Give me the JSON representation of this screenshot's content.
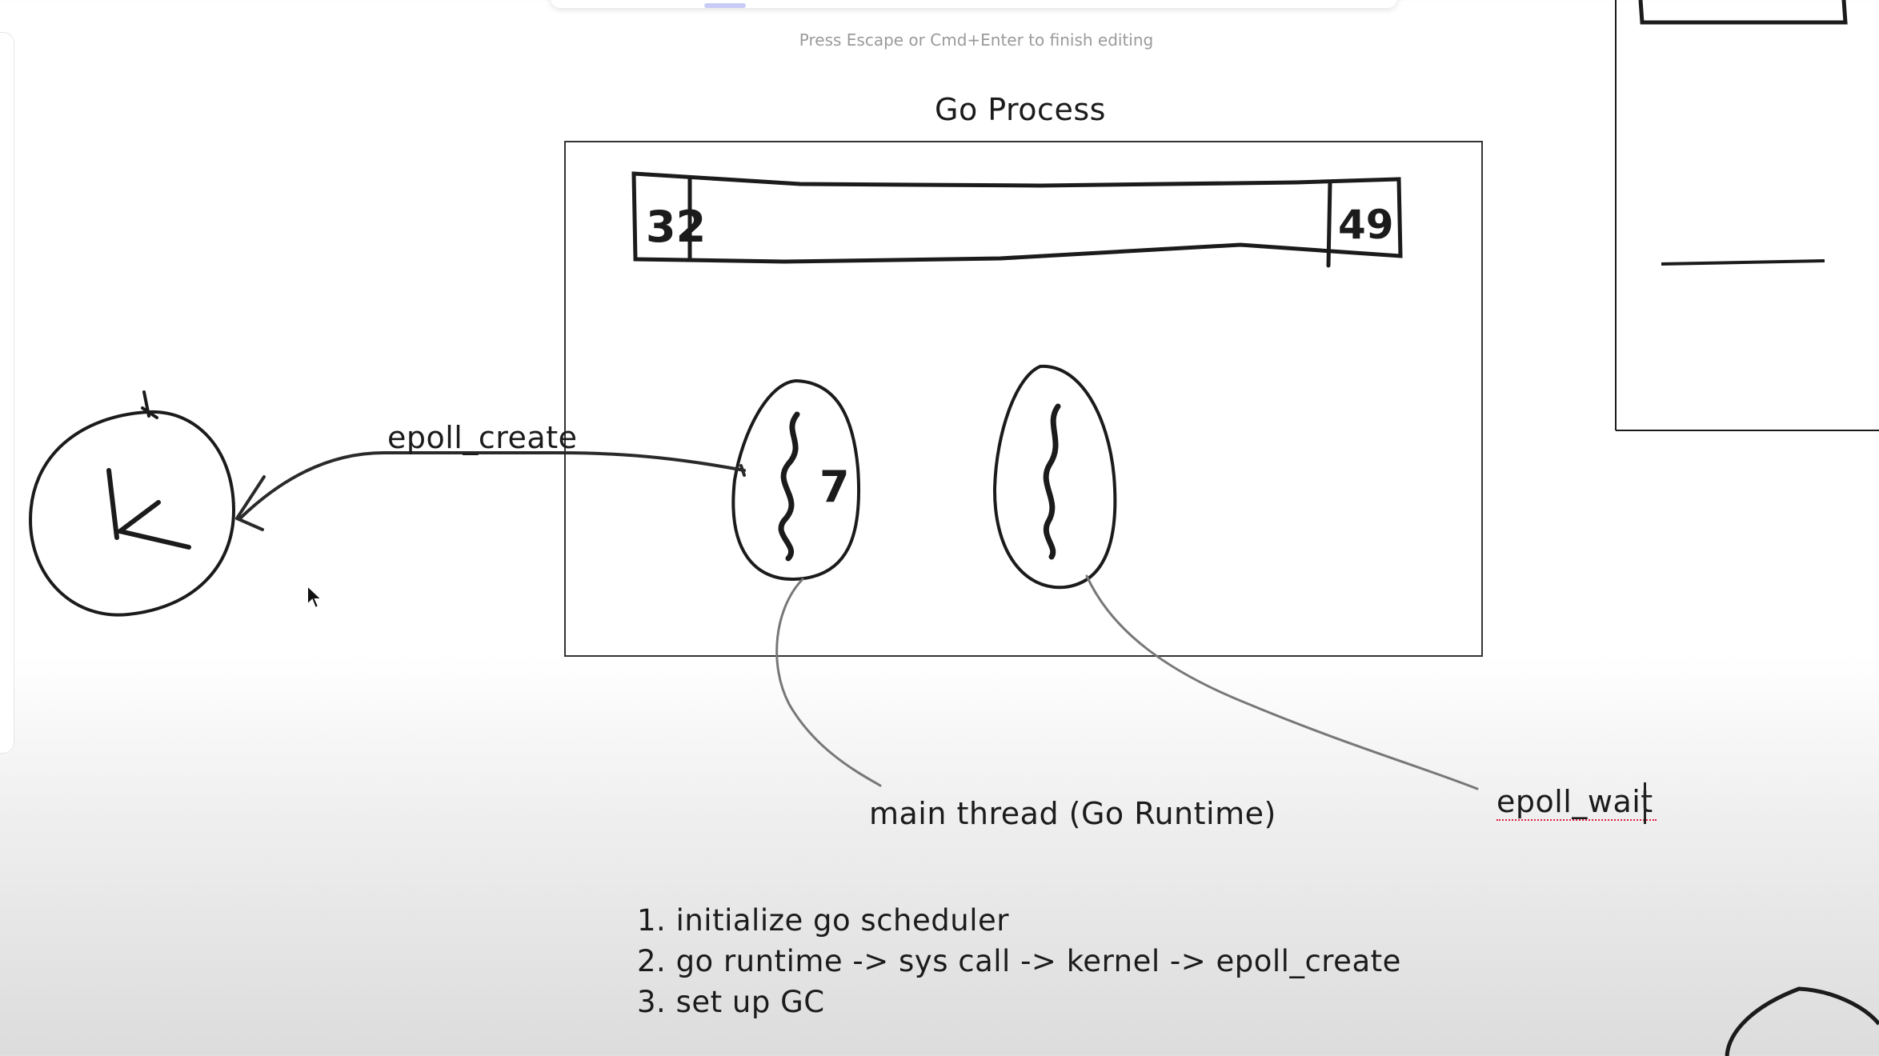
{
  "editor": {
    "hint": "Press Escape or Cmd+Enter to finish editing"
  },
  "diagram": {
    "title": "Go Process",
    "kernel_label": "K",
    "arrow_label": "epoll_create",
    "heap_left_label": "32",
    "heap_right_label": "49",
    "thread1_label": "7",
    "thread1_annotation": "main thread (Go Runtime)",
    "thread2_annotation": "epoll_wait"
  },
  "notes": {
    "steps": [
      "1. initialize go scheduler",
      "2. go runtime -> sys call -> kernel -> epoll_create",
      "3. set up GC"
    ]
  }
}
